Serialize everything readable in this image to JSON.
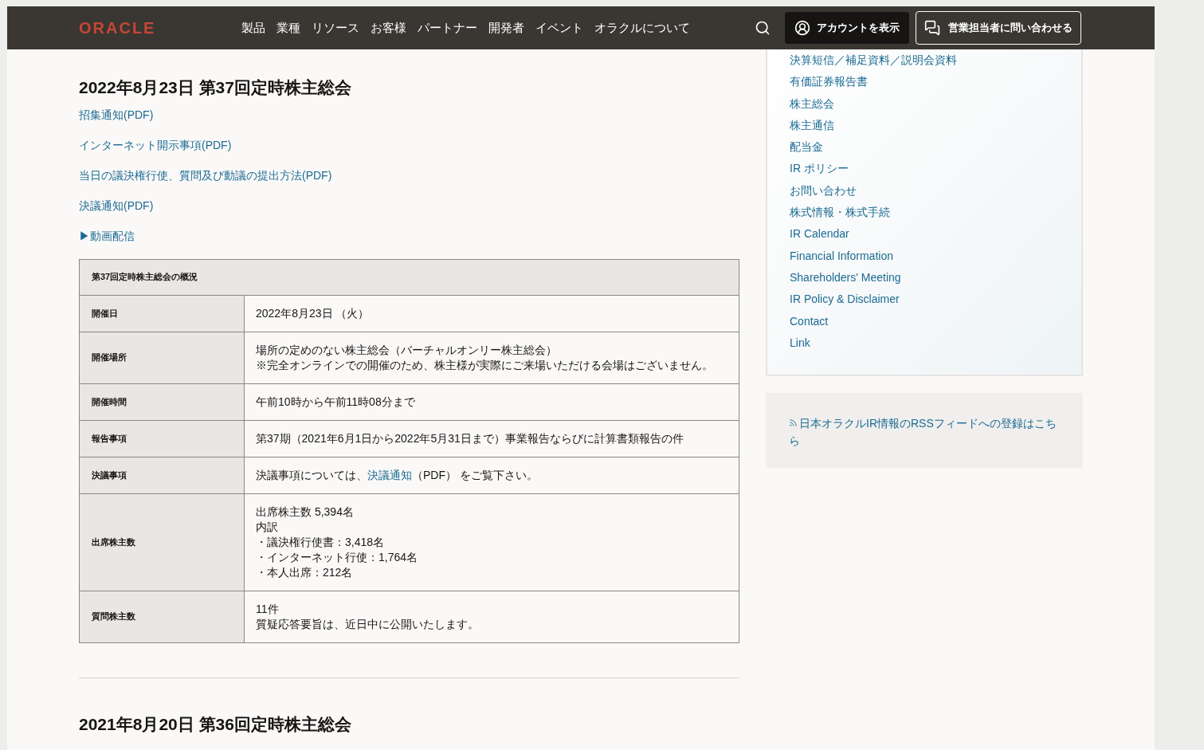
{
  "header": {
    "logo": "ORACLE",
    "nav": [
      "製品",
      "業種",
      "リソース",
      "お客様",
      "パートナー",
      "開発者",
      "イベント",
      "オラクルについて"
    ],
    "account_button": "アカウントを表示",
    "contact_button": "営業担当者に問い合わせる"
  },
  "main": {
    "heading": "2022年8月23日 第37回定時株主総会",
    "links": [
      {
        "label": "招集通知(PDF)",
        "kind": "link"
      },
      {
        "label": "インターネット開示事項(PDF)",
        "kind": "link"
      },
      {
        "label": "当日の議決権行使、質問及び動議の提出方法(PDF)",
        "kind": "link"
      },
      {
        "label": "決議通知(PDF)",
        "kind": "link"
      },
      {
        "label": "▶動画配信",
        "kind": "link"
      }
    ],
    "table": {
      "caption": "第37回定時株主総会の概況",
      "rows": [
        {
          "label": "開催日",
          "kind": "lines",
          "lines": [
            "2022年8月23日 （火）"
          ]
        },
        {
          "label": "開催場所",
          "kind": "lines",
          "lines": [
            "場所の定めのない株主総会（バーチャルオンリー株主総会）",
            "※完全オンラインでの開催のため、株主様が実際にご来場いただける会場はございません。"
          ]
        },
        {
          "label": "開催時間",
          "kind": "lines",
          "lines": [
            "午前10時から午前11時08分まで"
          ]
        },
        {
          "label": "報告事項",
          "kind": "lines",
          "lines": [
            "第37期（2021年6月1日から2022年5月31日まで）事業報告ならびに計算書類報告の件"
          ]
        },
        {
          "label": "決議事項",
          "kind": "link",
          "before": "決議事項については、",
          "link": "決議通知",
          "after": "（PDF） をご覧下さい。"
        },
        {
          "label": "出席株主数",
          "kind": "lines",
          "lines": [
            "出席株主数 5,394名",
            "内訳",
            "・議決権行使書：3,418名",
            "・インターネット行使：1,764名",
            "・本人出席：212名"
          ]
        },
        {
          "label": "質問株主数",
          "kind": "lines",
          "lines": [
            "11件",
            "質疑応答要旨は、近日中に公開いたします。"
          ]
        }
      ]
    },
    "next_heading": "2021年8月20日 第36回定時株主総会"
  },
  "sidebar": {
    "items": [
      "決算短信／補足資料／説明会資料",
      "有価証券報告書",
      "株主総会",
      "株主通信",
      "配当金",
      "IR ポリシー",
      "お問い合わせ",
      "株式情報・株式手続",
      "IR Calendar",
      "Financial Information",
      "Shareholders' Meeting",
      "IR Policy & Disclaimer",
      "Contact",
      "Link"
    ],
    "rss": "日本オラクルIR情報のRSSフィードへの登録はこちら"
  }
}
